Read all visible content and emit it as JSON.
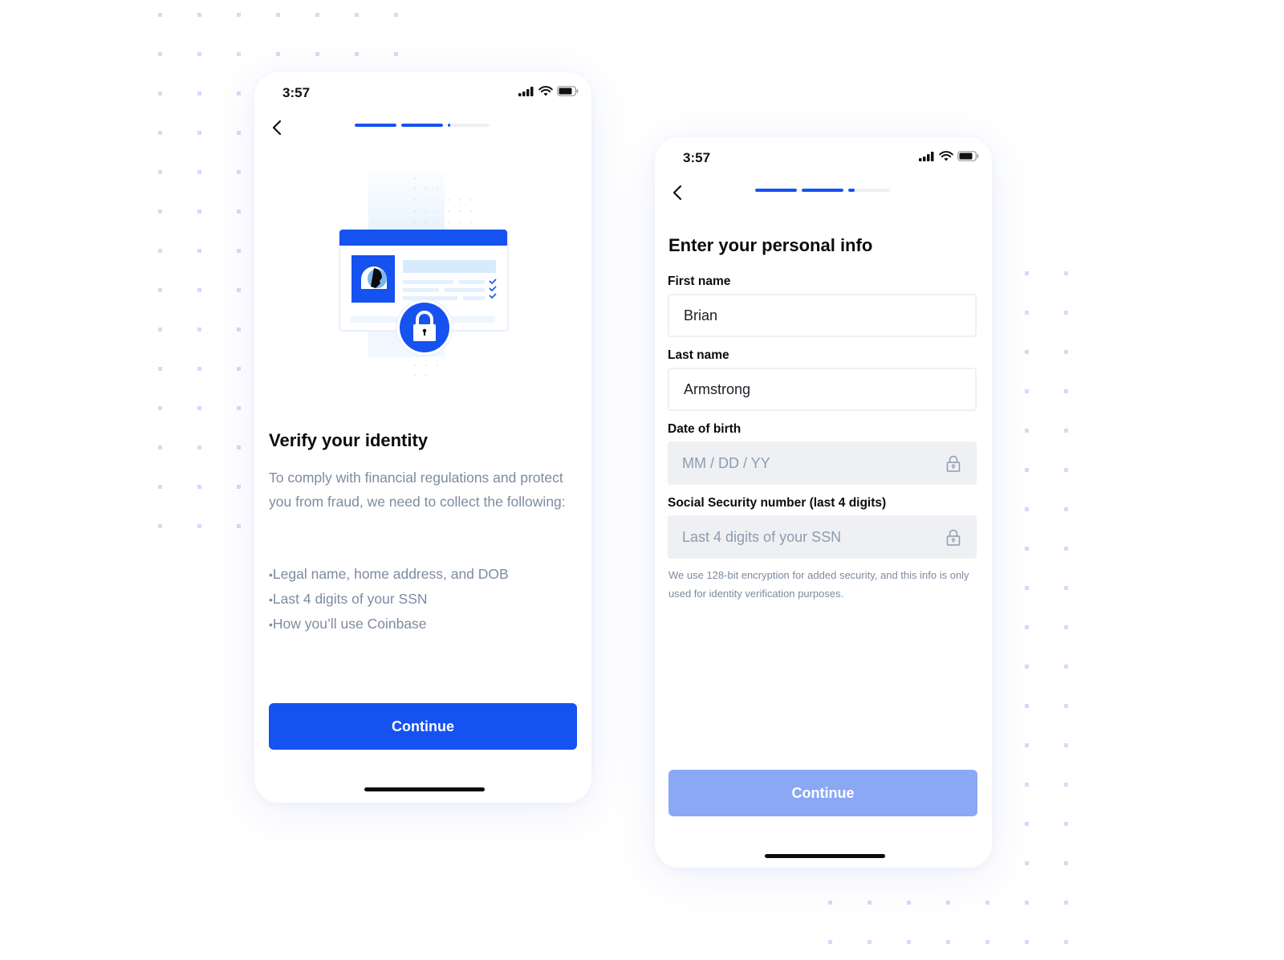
{
  "colors": {
    "brand_blue": "#1652f0",
    "disabled_blue": "#8ba8f5",
    "text_primary": "#0a0b0d",
    "text_secondary": "#7d8ba0",
    "field_locked_bg": "#eef0f3"
  },
  "screens": {
    "left": {
      "status_bar": {
        "time": "3:57",
        "icons": [
          "signal-icon",
          "wifi-icon",
          "battery-icon"
        ]
      },
      "back_icon": "chevron-left-icon",
      "progress": {
        "segments": [
          1.0,
          1.0,
          0.05
        ]
      },
      "illustration": "id-card-lock-illustration",
      "title": "Verify your identity",
      "description": "To comply with financial regulations and protect you from fraud, we need to collect the following:",
      "bullets": [
        "Legal name, home address, and DOB",
        "Last 4 digits of your SSN",
        "How you’ll use Coinbase"
      ],
      "continue_label": "Continue"
    },
    "right": {
      "status_bar": {
        "time": "3:57",
        "icons": [
          "signal-icon",
          "wifi-icon",
          "battery-icon"
        ]
      },
      "back_icon": "chevron-left-icon",
      "progress": {
        "segments": [
          1.0,
          1.0,
          0.15
        ]
      },
      "title": "Enter your personal info",
      "fields": [
        {
          "label": "First name",
          "value": "Brian",
          "placeholder": "",
          "locked": false
        },
        {
          "label": "Last name",
          "value": "Armstrong",
          "placeholder": "",
          "locked": false
        },
        {
          "label": "Date of birth",
          "value": "",
          "placeholder": "MM / DD / YY",
          "locked": true
        },
        {
          "label": "Social Security number (last 4 digits)",
          "value": "",
          "placeholder": "Last 4 digits of your SSN",
          "locked": true
        }
      ],
      "helper_text": "We use 128-bit encryption for added security, and this info is only used for identity verification purposes.",
      "continue_label": "Continue",
      "continue_disabled": true
    }
  }
}
